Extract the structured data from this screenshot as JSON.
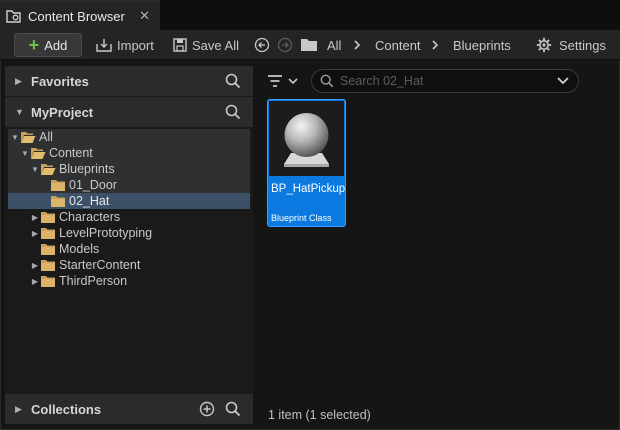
{
  "tab": {
    "title": "Content Browser",
    "close": "✕"
  },
  "toolbar": {
    "add_label": "Add",
    "import_label": "Import",
    "saveall_label": "Save All",
    "settings_label": "Settings",
    "breadcrumbs": [
      "All",
      "Content",
      "Blueprints"
    ],
    "separator": "›"
  },
  "sidebar": {
    "favorites_label": "Favorites",
    "project_label": "MyProject",
    "collections_label": "Collections",
    "tree": [
      {
        "label": "All",
        "expanded": true
      },
      {
        "label": "Content",
        "expanded": true
      },
      {
        "label": "Blueprints",
        "expanded": true
      },
      {
        "label": "01_Door"
      },
      {
        "label": "02_Hat",
        "selected": true
      },
      {
        "label": "Characters",
        "expanded": false
      },
      {
        "label": "LevelPrototyping",
        "expanded": false
      },
      {
        "label": "Models"
      },
      {
        "label": "StarterContent",
        "expanded": false
      },
      {
        "label": "ThirdPerson",
        "expanded": false
      }
    ]
  },
  "main": {
    "search_placeholder": "Search 02_Hat",
    "asset": {
      "name": "BP_HatPickup",
      "type": "Blueprint Class"
    },
    "status": "1 item (1 selected)"
  },
  "colors": {
    "accent": "#0b79e0",
    "selection": "#3c5068",
    "add_icon": "#6bc44a",
    "folder": "#c9a25a"
  }
}
